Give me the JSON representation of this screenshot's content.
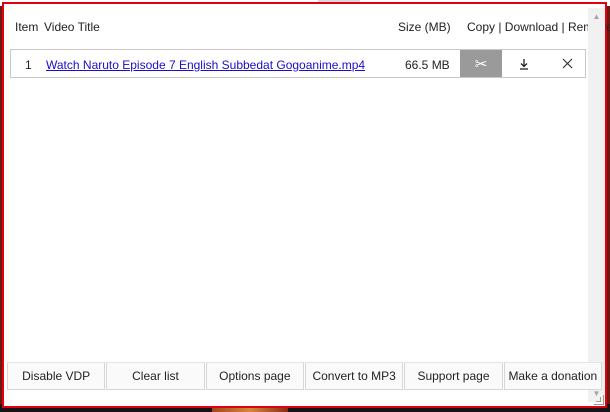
{
  "table": {
    "headers": {
      "item": "Item",
      "video_title": "Video Title",
      "size": "Size (MB)",
      "actions": "Copy | Download | Remove"
    },
    "rows": [
      {
        "item": "1",
        "title": "Watch Naruto Episode 7 English Subbedat Gogoanime.mp4",
        "size": "66.5 MB",
        "copy_icon": "scissors-icon",
        "download_icon": "download-icon",
        "remove_icon": "close-icon"
      }
    ]
  },
  "footer": {
    "buttons": [
      "Disable VDP",
      "Clear list",
      "Options page",
      "Convert to MP3",
      "Support page",
      "Make a donation"
    ]
  },
  "colors": {
    "popup_border": "#e0000f",
    "link": "#1a0dcc",
    "copy_button_bg": "#9a9a9a"
  }
}
